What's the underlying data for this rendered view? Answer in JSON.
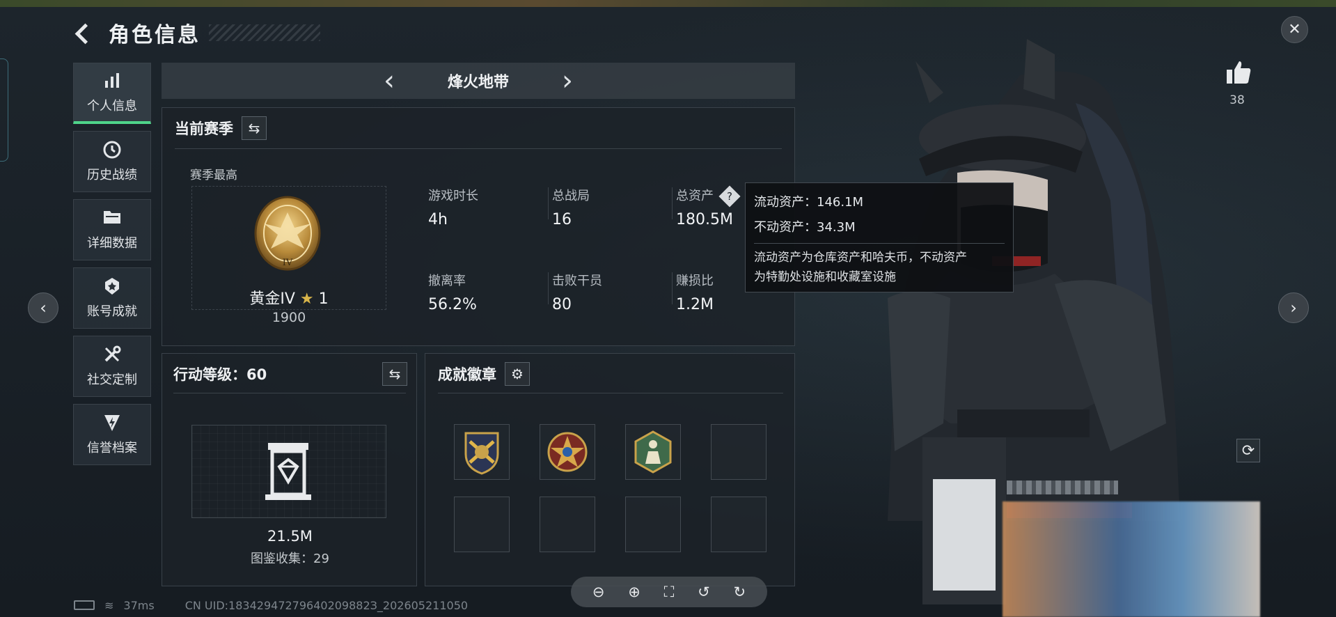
{
  "header": {
    "title": "角色信息"
  },
  "sidebar": {
    "items": [
      {
        "label": "个人信息",
        "icon": "bar-chart-icon",
        "active": true
      },
      {
        "label": "历史战绩",
        "icon": "history-clock-icon",
        "active": false
      },
      {
        "label": "详细数据",
        "icon": "folder-icon",
        "active": false
      },
      {
        "label": "账号成就",
        "icon": "medal-icon",
        "active": false
      },
      {
        "label": "社交定制",
        "icon": "tools-icon",
        "active": false
      },
      {
        "label": "信誉档案",
        "icon": "shield-lightning-icon",
        "active": false
      }
    ]
  },
  "mode": {
    "name": "烽火地带"
  },
  "season": {
    "title": "当前赛季",
    "best_label": "赛季最高",
    "rank_name": "黄金IV",
    "rank_stars": "1",
    "rank_score": "1900",
    "rank_emblem_numeral": "IV",
    "stats": [
      {
        "label": "游戏时长",
        "value": "4h"
      },
      {
        "label": "总战局",
        "value": "16"
      },
      {
        "label": "总资产",
        "value": "180.5M"
      },
      {
        "label": "撤离率",
        "value": "56.2%"
      },
      {
        "label": "击败干员",
        "value": "80"
      },
      {
        "label": "赚损比",
        "value": "1.2M"
      }
    ]
  },
  "tooltip": {
    "liquid": "流动资产：146.1M",
    "fixed": "不动资产：34.3M",
    "desc_line1": "流动资产为仓库资产和哈夫币，不动资产",
    "desc_line2": "为特勤处设施和收藏室设施"
  },
  "action_level": {
    "title": "行动等级：60",
    "value": "21.5M",
    "collection": "图鉴收集：29"
  },
  "badges": {
    "title": "成就徽章",
    "slots": [
      "badge-crossed-arrows-icon",
      "badge-star-wreath-icon",
      "badge-figure-hexagon-icon",
      "",
      "",
      "",
      "",
      ""
    ]
  },
  "like": {
    "count": "38"
  },
  "status": {
    "ping": "37ms",
    "uid": "CN UID:18342947279640209882З_202605211050"
  },
  "colors": {
    "accent": "#4fd48a",
    "panel": "#1c2228",
    "gold": "#c9a24a"
  }
}
